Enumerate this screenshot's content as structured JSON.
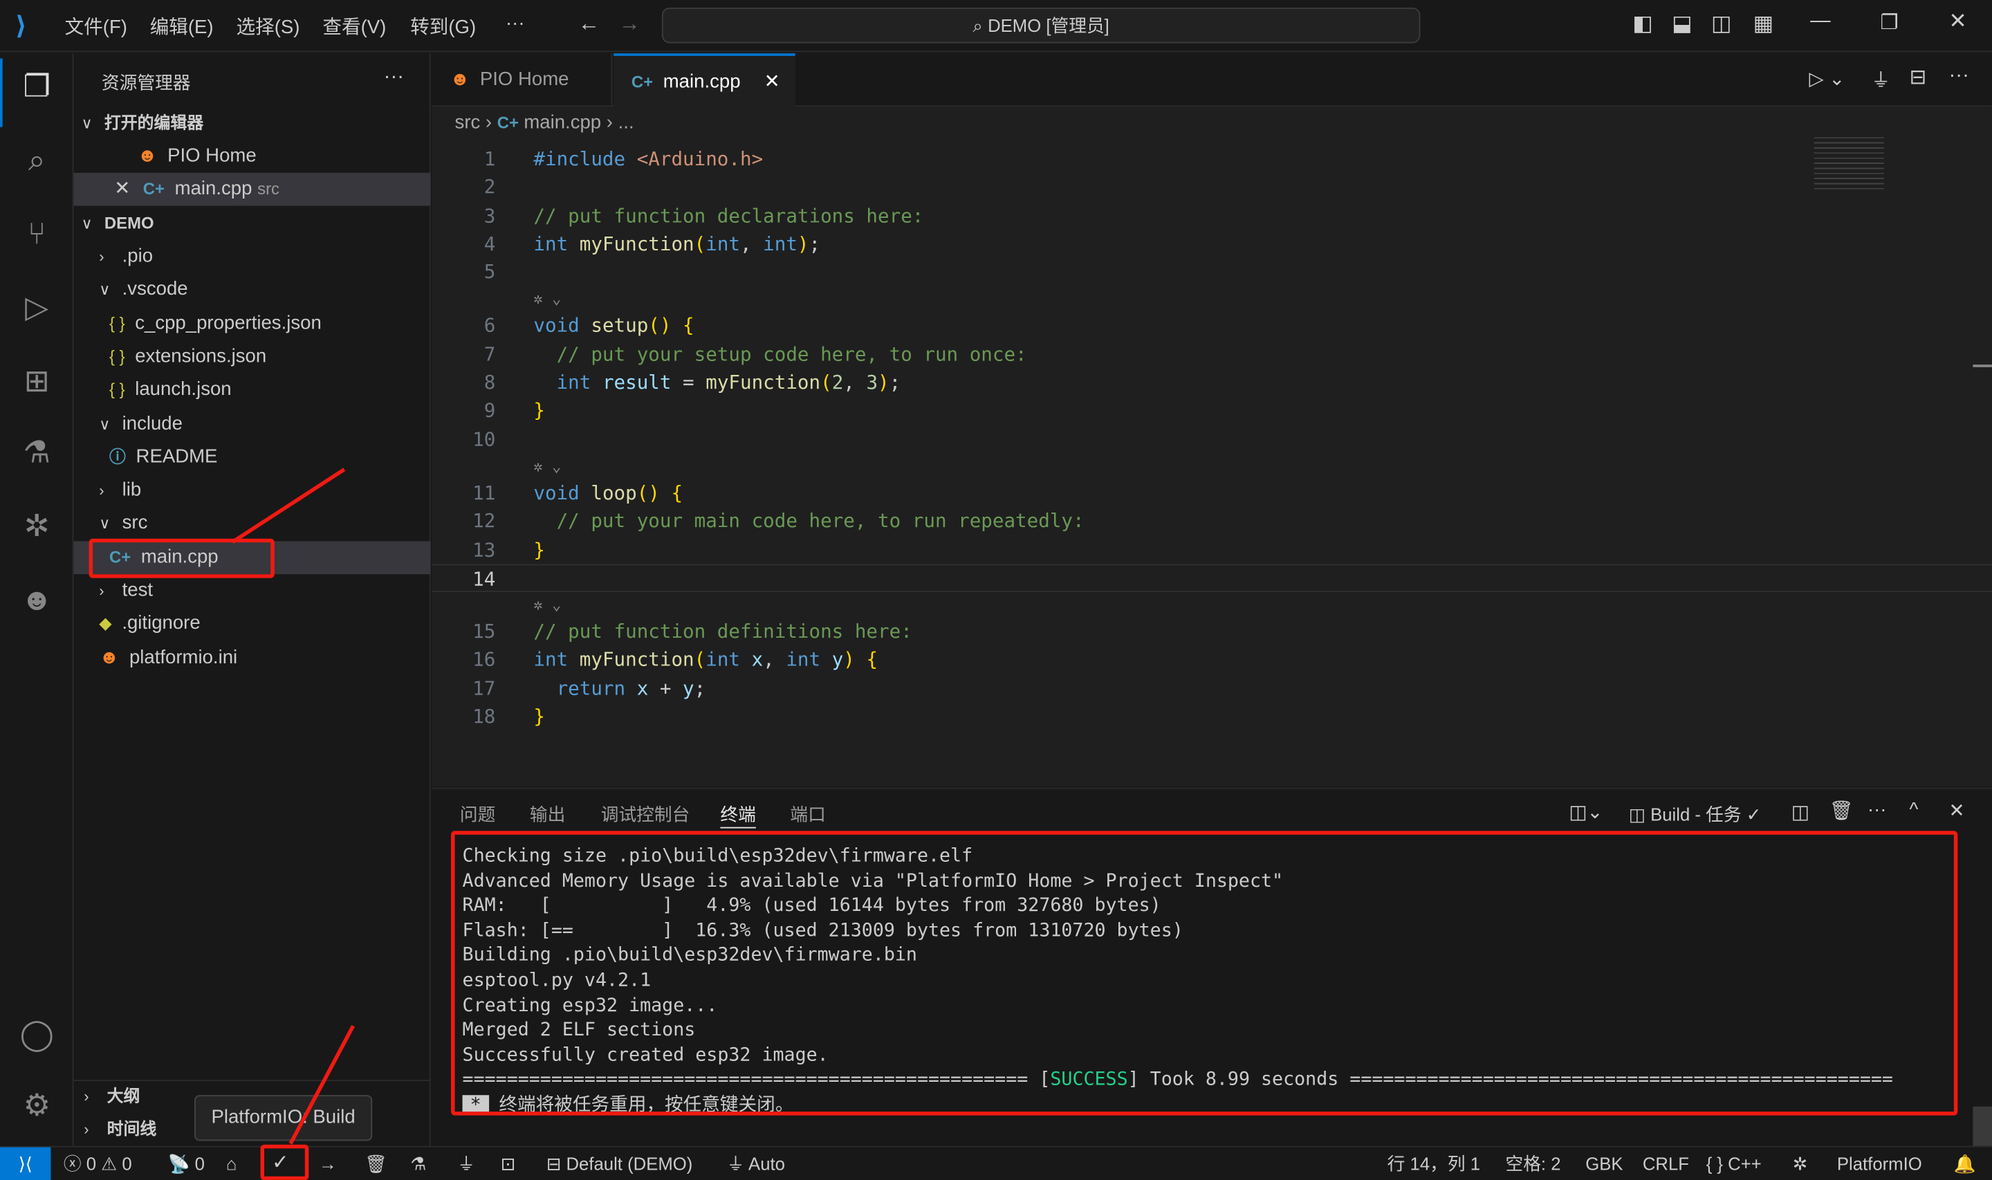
{
  "titlebar": {
    "menus": [
      "文件(F)",
      "编辑(E)",
      "选择(S)",
      "查看(V)",
      "转到(G)",
      "···"
    ],
    "search": "DEMO [管理员]"
  },
  "explorer": {
    "title": "资源管理器",
    "more": "···",
    "open_editors": "打开的编辑器",
    "open": [
      {
        "name": "PIO Home"
      },
      {
        "name": "main.cpp",
        "desc": "src"
      }
    ],
    "project": "DEMO",
    "items": [
      {
        "label": ".pio",
        "type": "folder",
        "open": false,
        "depth": 1
      },
      {
        "label": ".vscode",
        "type": "folder",
        "open": true,
        "depth": 1
      },
      {
        "label": "c_cpp_properties.json",
        "type": "json",
        "depth": 2
      },
      {
        "label": "extensions.json",
        "type": "json",
        "depth": 2
      },
      {
        "label": "launch.json",
        "type": "json",
        "depth": 2
      },
      {
        "label": "include",
        "type": "folder",
        "open": true,
        "depth": 1
      },
      {
        "label": "README",
        "type": "info",
        "depth": 2
      },
      {
        "label": "lib",
        "type": "folder",
        "open": false,
        "depth": 1
      },
      {
        "label": "src",
        "type": "folder",
        "open": true,
        "depth": 1
      },
      {
        "label": "main.cpp",
        "type": "cpp",
        "depth": 2,
        "selected": true
      },
      {
        "label": "test",
        "type": "folder",
        "open": false,
        "depth": 1
      },
      {
        "label": ".gitignore",
        "type": "git",
        "depth": 1
      },
      {
        "label": "platformio.ini",
        "type": "pio",
        "depth": 1
      }
    ],
    "outline": "大纲",
    "timeline": "时间线"
  },
  "tabs": [
    {
      "label": "PIO Home"
    },
    {
      "label": "main.cpp",
      "active": true
    }
  ],
  "breadcrumb": {
    "folder": "src",
    "file": "main.cpp",
    "more": "..."
  },
  "code": [
    {
      "n": "1",
      "t": [
        [
          "#include ",
          "kw"
        ],
        [
          "<Arduino.h>",
          "st"
        ]
      ]
    },
    {
      "n": "2",
      "t": []
    },
    {
      "n": "3",
      "t": [
        [
          "// put function declarations here:",
          "cm"
        ]
      ]
    },
    {
      "n": "4",
      "t": [
        [
          "int ",
          "kw"
        ],
        [
          "myFunction",
          "fn"
        ],
        [
          "(",
          "br"
        ],
        [
          "int",
          "kw"
        ],
        [
          ", ",
          "pl"
        ],
        [
          "int",
          "kw"
        ],
        [
          ")",
          "br"
        ],
        [
          ";",
          "pl"
        ]
      ]
    },
    {
      "n": "5",
      "t": []
    },
    {
      "lens": true
    },
    {
      "n": "6",
      "t": [
        [
          "void ",
          "kw"
        ],
        [
          "setup",
          "fn"
        ],
        [
          "() {",
          "br"
        ]
      ]
    },
    {
      "n": "7",
      "t": [
        [
          "  // put your setup code here, to run once:",
          "cm"
        ]
      ]
    },
    {
      "n": "8",
      "t": [
        [
          "  int ",
          "kw"
        ],
        [
          "result",
          "pa"
        ],
        [
          " = ",
          "pl"
        ],
        [
          "myFunction",
          "fn"
        ],
        [
          "(",
          "br"
        ],
        [
          "2",
          "nu"
        ],
        [
          ", ",
          "pl"
        ],
        [
          "3",
          "nu"
        ],
        [
          ")",
          "br"
        ],
        [
          ";",
          "pl"
        ]
      ]
    },
    {
      "n": "9",
      "t": [
        [
          "}",
          "br"
        ]
      ]
    },
    {
      "n": "10",
      "t": []
    },
    {
      "lens": true
    },
    {
      "n": "11",
      "t": [
        [
          "void ",
          "kw"
        ],
        [
          "loop",
          "fn"
        ],
        [
          "() {",
          "br"
        ]
      ]
    },
    {
      "n": "12",
      "t": [
        [
          "  // put your main code here, to run repeatedly:",
          "cm"
        ]
      ]
    },
    {
      "n": "13",
      "t": [
        [
          "}",
          "br"
        ]
      ]
    },
    {
      "n": "14",
      "t": [],
      "current": true
    },
    {
      "lens": true
    },
    {
      "n": "15",
      "t": [
        [
          "// put function definitions here:",
          "cm"
        ]
      ]
    },
    {
      "n": "16",
      "t": [
        [
          "int ",
          "kw"
        ],
        [
          "myFunction",
          "fn"
        ],
        [
          "(",
          "br"
        ],
        [
          "int ",
          "kw"
        ],
        [
          "x",
          "pa"
        ],
        [
          ", ",
          "pl"
        ],
        [
          "int ",
          "kw"
        ],
        [
          "y",
          "pa"
        ],
        [
          ") {",
          "br"
        ]
      ]
    },
    {
      "n": "17",
      "t": [
        [
          "  return ",
          "kw"
        ],
        [
          "x",
          "pa"
        ],
        [
          " + ",
          "pl"
        ],
        [
          "y",
          "pa"
        ],
        [
          ";",
          "pl"
        ]
      ]
    },
    {
      "n": "18",
      "t": [
        [
          "}",
          "br"
        ]
      ]
    }
  ],
  "panel": {
    "tabs": [
      "问题",
      "输出",
      "调试控制台",
      "终端",
      "端口"
    ],
    "active_tab": "终端",
    "task": "Build - 任务",
    "terminal": [
      "Checking size .pio\\build\\esp32dev\\firmware.elf",
      "Advanced Memory Usage is available via \"PlatformIO Home > Project Inspect\"",
      "RAM:   [          ]   4.9% (used 16144 bytes from 327680 bytes)",
      "Flash: [==        ]  16.3% (used 213009 bytes from 1310720 bytes)",
      "Building .pio\\build\\esp32dev\\firmware.bin",
      "esptool.py v4.2.1",
      "Creating esp32 image...",
      "Merged 2 ELF sections",
      "Successfully created esp32 image."
    ],
    "success_rule_left": "=================================================== [",
    "success": "SUCCESS",
    "success_rule_right": "] Took 8.99 seconds =================================================",
    "reuse_marker": "*",
    "reuse_msg": "终端将被任务重用，按任意键关闭。"
  },
  "tooltip": "PlatformIO: Build",
  "status": {
    "errors": "0",
    "warnings": "0",
    "ports": "0",
    "env": "Default (DEMO)",
    "port": "Auto",
    "position": "行 14，列 1",
    "spaces": "空格: 2",
    "encoding": "GBK",
    "eol": "CRLF",
    "lang": "C++",
    "platform": "PlatformIO"
  },
  "colors": {
    "accent": "#0078d4",
    "highlight": "#f01a12",
    "success": "#23d18b"
  }
}
